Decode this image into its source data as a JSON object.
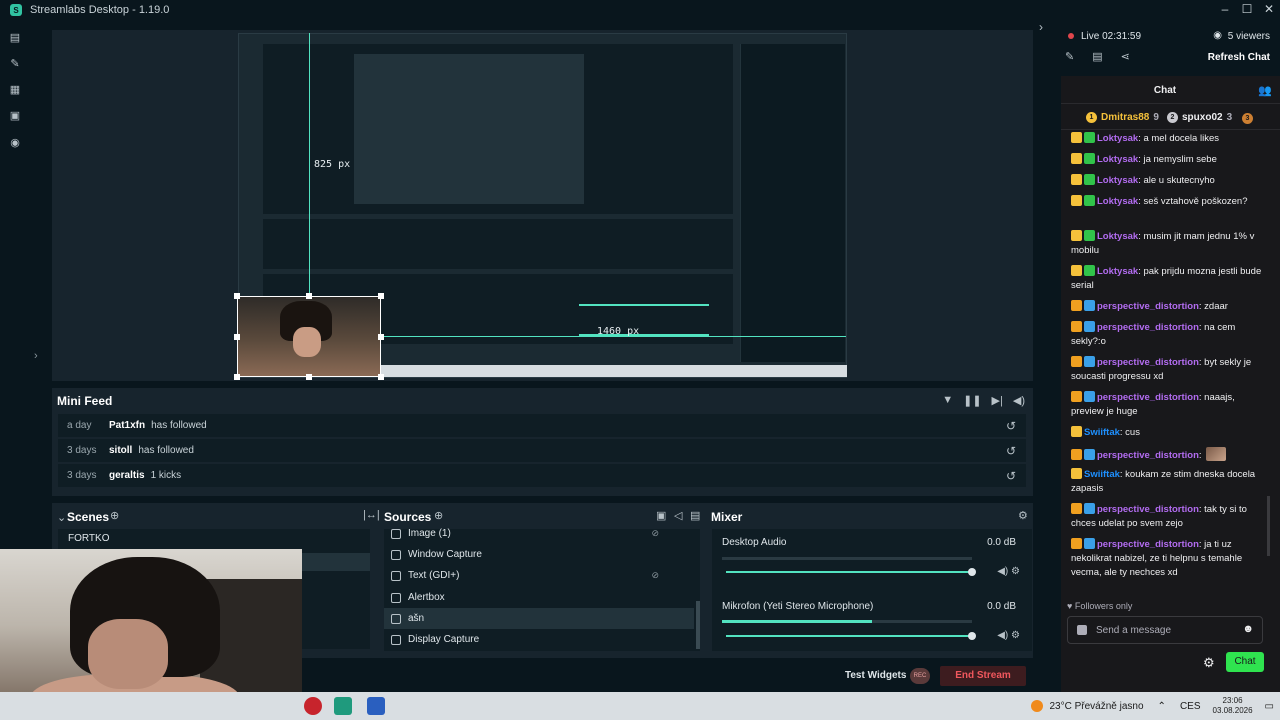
{
  "window": {
    "title": "Streamlabs Desktop - 1.19.0",
    "controls": [
      "–",
      "☐",
      "✕"
    ]
  },
  "nav": {
    "icons": [
      "editor-icon",
      "themes-icon",
      "store-icon",
      "layout-icon",
      "record-icon"
    ]
  },
  "preview": {
    "width_label": "825 px",
    "height_label": "1460 px"
  },
  "minifeed": {
    "title": "Mini Feed",
    "events": [
      {
        "time": "a day",
        "user": "Pat1xfn",
        "action": "has followed"
      },
      {
        "time": "3 days",
        "user": "sitoll",
        "action": "has followed"
      },
      {
        "time": "3 days",
        "user": "geraltis",
        "action": "1 kicks"
      }
    ]
  },
  "scenes": {
    "title": "Scenes",
    "items": [
      "FORTKO"
    ]
  },
  "sources": {
    "title": "Sources",
    "items": [
      "Image (1)",
      "Window Capture",
      "Text (GDI+)",
      "Alertbox",
      "ašn",
      "Display Capture"
    ]
  },
  "mixer": {
    "title": "Mixer",
    "channels": [
      {
        "name": "Desktop Audio",
        "db": "0.0 dB",
        "level": 0.0
      },
      {
        "name": "Mikrofon (Yeti Stereo Microphone)",
        "db": "0.0 dB",
        "level": 0.6
      }
    ]
  },
  "footer": {
    "test_widgets": "Test Widgets",
    "rec_label": "REC",
    "end_stream": "End Stream"
  },
  "live": {
    "status": "Live 02:31:59",
    "viewers": "5 viewers",
    "refresh": "Refresh Chat"
  },
  "chat": {
    "title": "Chat",
    "leaderboard": [
      {
        "name": "Dmitras88",
        "count": "9"
      },
      {
        "name": "spuxo02",
        "count": "3"
      }
    ],
    "messages": [
      {
        "user": "Loktysak",
        "text": ": a mel docela likes"
      },
      {
        "user": "Loktysak",
        "text": ": ja nemyslim sebe"
      },
      {
        "user": "Loktysak",
        "text": ": ale u skutecnyho"
      },
      {
        "user": "Loktysak",
        "text": ": seš vztahově poškozen?"
      },
      {
        "user": "Loktysak",
        "text": ": musim jit mam jednu 1% v mobilu"
      },
      {
        "user": "Loktysak",
        "text": ": pak prijdu mozna jestli bude serial"
      },
      {
        "user": "perspective_distortion",
        "text": ": zdaar"
      },
      {
        "user": "perspective_distortion",
        "text": ": na cem sekly?:o"
      },
      {
        "user": "perspective_distortion",
        "text": ": byt sekly je soucasti progressu xd"
      },
      {
        "user": "perspective_distortion",
        "text": ": naaajs, preview je huge"
      },
      {
        "user": "Swiiftak",
        "text": ": cus"
      },
      {
        "user": "perspective_distortion",
        "text": ":"
      },
      {
        "user": "Swiiftak",
        "text": ": koukam ze stim dneska docela zapasis"
      },
      {
        "user": "perspective_distortion",
        "text": ": tak ty si to chces udelat po svem zejo"
      },
      {
        "user": "perspective_distortion",
        "text": ": ja ti uz nekolikrat nabizel, ze ti helpnu s temahle vecma, ale ty nechces xd"
      }
    ],
    "followers_only": "Followers only",
    "input_placeholder": "Send a message",
    "send_label": "Chat"
  },
  "taskbar": {
    "weather": "23°C  Převážně jasno",
    "language": "CES",
    "time": "23:06",
    "date": "03.08.2026"
  },
  "colors": {
    "accent": "#31c3a2",
    "live": "#e0464c",
    "chat_send": "#2fe34f",
    "end_stream": "#f0575d"
  }
}
